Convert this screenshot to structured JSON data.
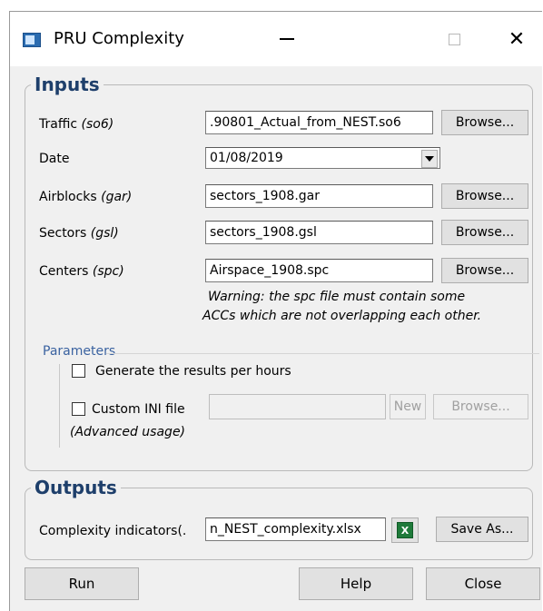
{
  "window": {
    "title": "PRU Complexity",
    "close_glyph": "✕"
  },
  "inputs": {
    "legend": "Inputs",
    "browse_label": "Browse...",
    "traffic": {
      "label": "Traffic ",
      "hint": "(so6)",
      "value": ".90801_Actual_from_NEST.so6"
    },
    "date": {
      "label": "Date",
      "value": "01/08/2019"
    },
    "airblocks": {
      "label": "Airblocks ",
      "hint": "(gar)",
      "value": "sectors_1908.gar"
    },
    "sectors": {
      "label": "Sectors ",
      "hint": "(gsl)",
      "value": "sectors_1908.gsl"
    },
    "centers": {
      "label": "Centers ",
      "hint": "(spc)",
      "value": "Airspace_1908.spc"
    },
    "warning_line1": "Warning: the spc file must contain some",
    "warning_line2": "ACCs which are not overlapping each other."
  },
  "parameters": {
    "label": "Parameters",
    "per_hours_label": "Generate the results per hours",
    "per_hours_checked": false,
    "custom_ini_label": "Custom INI file",
    "custom_ini_checked": false,
    "custom_ini_value": "",
    "new_label": "New",
    "browse_label": "Browse...",
    "advanced_note": "(Advanced usage)"
  },
  "outputs": {
    "legend": "Outputs",
    "complexity_label": "Complexity indicators(.",
    "complexity_value": "n_NEST_complexity.xlsx",
    "excel_icon": "excel-icon",
    "excel_glyph": "X",
    "save_as_label": "Save As..."
  },
  "footer": {
    "run_label": "Run",
    "help_label": "Help",
    "close_label": "Close"
  }
}
